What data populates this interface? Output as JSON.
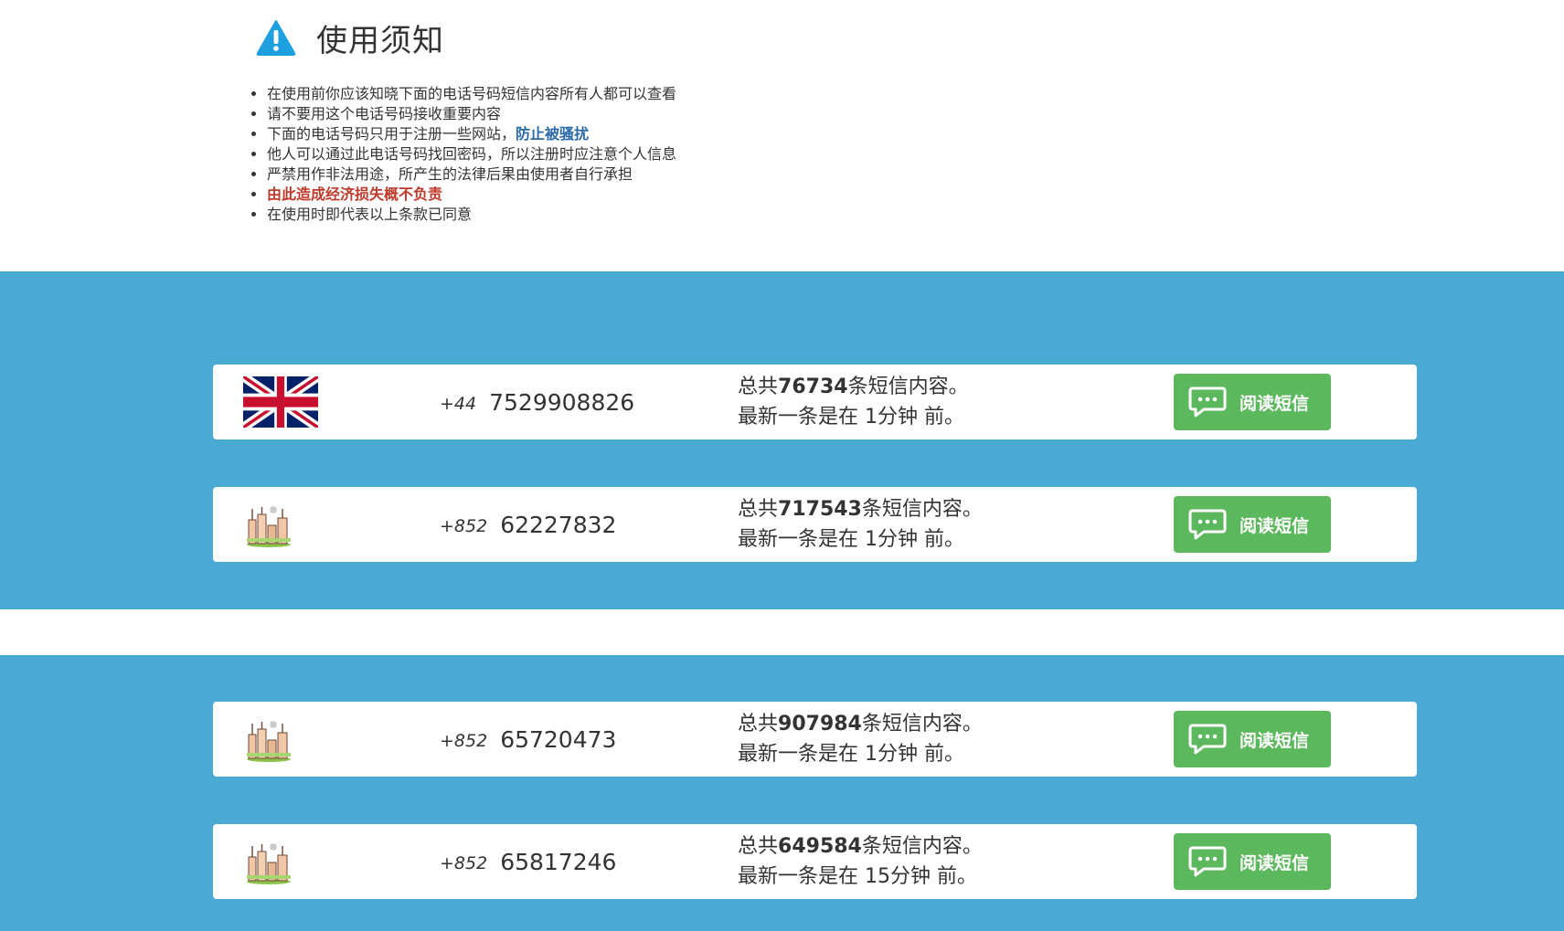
{
  "notice": {
    "title": "使用须知",
    "items": [
      "在使用前你应该知晓下面的电话号码短信内容所有人都可以查看",
      "请不要用这个电话号码接收重要内容",
      "下面的电话号码只用于注册一些网站，",
      "防止被骚扰",
      "他人可以通过此电话号码找回密码，所以注册时应注意个人信息",
      "严禁用作非法用途，所产生的法律后果由使用者自行承担",
      "由此造成经济损失概不负责",
      "在使用时即代表以上条款已同意"
    ]
  },
  "labels": {
    "total_prefix": "总共",
    "total_suffix": "条短信内容。",
    "latest_prefix": "最新一条是在",
    "read_button": "阅读短信"
  },
  "numbers": [
    {
      "flag": "uk-flag",
      "country_code": "+44",
      "number": "7529908826",
      "total": "76734",
      "latest": "1分钟 前。"
    },
    {
      "flag": "hong-kong-city-icon",
      "country_code": "+852",
      "number": "62227832",
      "total": "717543",
      "latest": "1分钟 前。"
    },
    {
      "flag": "hong-kong-city-icon",
      "country_code": "+852",
      "number": "65720473",
      "total": "907984",
      "latest": "1分钟 前。"
    },
    {
      "flag": "hong-kong-city-icon",
      "country_code": "+852",
      "number": "65817246",
      "total": "649584",
      "latest": "15分钟 前。"
    }
  ],
  "colors": {
    "band_blue": "#4baad4",
    "button_green": "#5cb85c",
    "warning_blue": "#1e9fe0",
    "link_blue": "#2a6aa8",
    "warning_red": "#c0392b"
  }
}
